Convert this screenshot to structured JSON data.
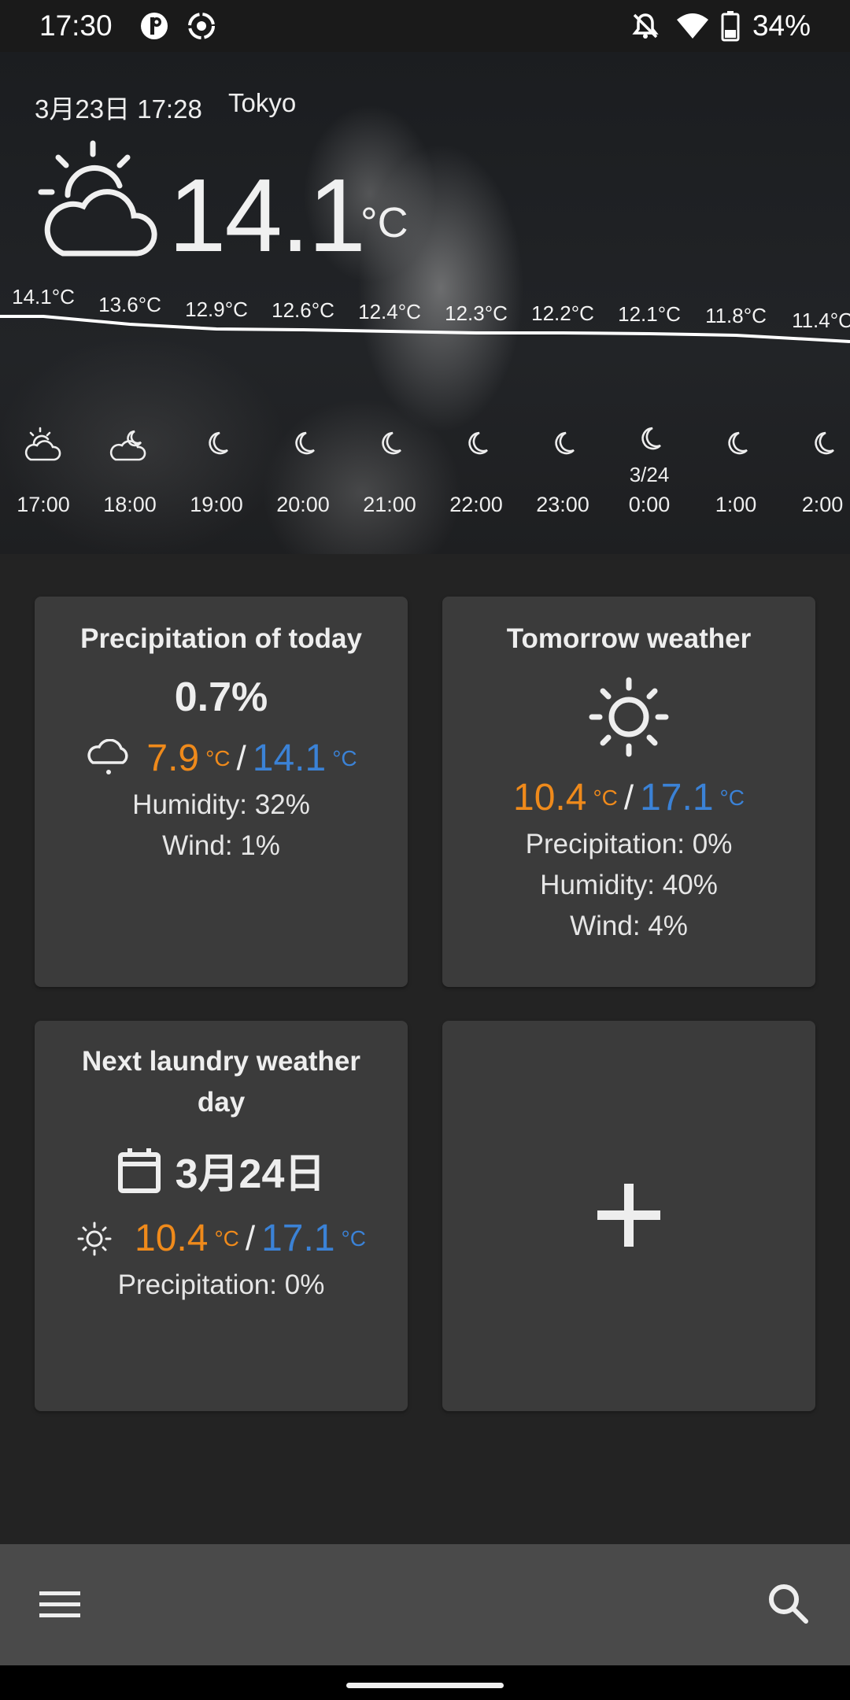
{
  "status_bar": {
    "time": "17:30",
    "battery": "34%",
    "icons": [
      "app-p-icon",
      "record-icon",
      "notifications-off-icon",
      "wifi-icon",
      "battery-icon"
    ]
  },
  "hero": {
    "date_time": "3月23日 17:28",
    "city": "Tokyo",
    "current_temp": "14.1",
    "unit": "°C",
    "current_icon": "partly-cloudy-day-icon"
  },
  "hourly": [
    {
      "temp": "14.1°C",
      "time": "17:00",
      "date": "",
      "icon": "partly-cloudy-day-icon"
    },
    {
      "temp": "13.6°C",
      "time": "18:00",
      "date": "",
      "icon": "partly-cloudy-night-icon"
    },
    {
      "temp": "12.9°C",
      "time": "19:00",
      "date": "",
      "icon": "moon-icon"
    },
    {
      "temp": "12.6°C",
      "time": "20:00",
      "date": "",
      "icon": "moon-icon"
    },
    {
      "temp": "12.4°C",
      "time": "21:00",
      "date": "",
      "icon": "moon-icon"
    },
    {
      "temp": "12.3°C",
      "time": "22:00",
      "date": "",
      "icon": "moon-icon"
    },
    {
      "temp": "12.2°C",
      "time": "23:00",
      "date": "",
      "icon": "moon-icon"
    },
    {
      "temp": "12.1°C",
      "time": "0:00",
      "date": "3/24",
      "icon": "moon-icon"
    },
    {
      "temp": "11.8°C",
      "time": "1:00",
      "date": "",
      "icon": "moon-icon"
    },
    {
      "temp": "11.4°C",
      "time": "2:00",
      "date": "",
      "icon": "moon-icon"
    }
  ],
  "cards": {
    "precip_today": {
      "title": "Precipitation of today",
      "value": "0.7%",
      "icon": "drizzle-icon",
      "low": "7.9",
      "high": "14.1",
      "unit": "°C",
      "slash": "/",
      "humidity": "Humidity: 32%",
      "wind": "Wind: 1%"
    },
    "tomorrow": {
      "title": "Tomorrow weather",
      "icon": "sun-icon",
      "low": "10.4",
      "high": "17.1",
      "unit": "°C",
      "slash": "/",
      "precip": "Precipitation: 0%",
      "humidity": "Humidity: 40%",
      "wind": "Wind: 4%"
    },
    "laundry": {
      "title": "Next laundry weather day",
      "date": "3月24日",
      "icon": "sun-icon",
      "low": "10.4",
      "high": "17.1",
      "unit": "°C",
      "slash": "/",
      "precip": "Precipitation: 0%"
    },
    "add": {
      "icon": "plus-icon"
    }
  },
  "bottom_bar": {
    "menu_icon": "menu-icon",
    "search_icon": "search-icon"
  },
  "colors": {
    "low_temp": "#ef8a1b",
    "high_temp": "#3b82d6",
    "card_bg": "#3b3b3b",
    "page_bg": "#232323"
  }
}
